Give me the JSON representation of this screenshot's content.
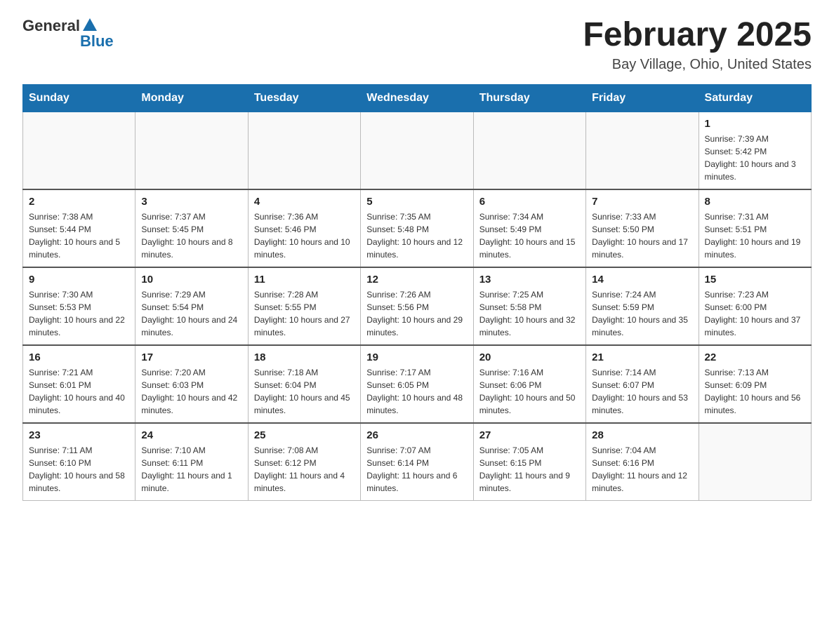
{
  "logo": {
    "general": "General",
    "blue": "Blue"
  },
  "title": "February 2025",
  "location": "Bay Village, Ohio, United States",
  "days_of_week": [
    "Sunday",
    "Monday",
    "Tuesday",
    "Wednesday",
    "Thursday",
    "Friday",
    "Saturday"
  ],
  "weeks": [
    [
      {
        "day": "",
        "info": ""
      },
      {
        "day": "",
        "info": ""
      },
      {
        "day": "",
        "info": ""
      },
      {
        "day": "",
        "info": ""
      },
      {
        "day": "",
        "info": ""
      },
      {
        "day": "",
        "info": ""
      },
      {
        "day": "1",
        "info": "Sunrise: 7:39 AM\nSunset: 5:42 PM\nDaylight: 10 hours and 3 minutes."
      }
    ],
    [
      {
        "day": "2",
        "info": "Sunrise: 7:38 AM\nSunset: 5:44 PM\nDaylight: 10 hours and 5 minutes."
      },
      {
        "day": "3",
        "info": "Sunrise: 7:37 AM\nSunset: 5:45 PM\nDaylight: 10 hours and 8 minutes."
      },
      {
        "day": "4",
        "info": "Sunrise: 7:36 AM\nSunset: 5:46 PM\nDaylight: 10 hours and 10 minutes."
      },
      {
        "day": "5",
        "info": "Sunrise: 7:35 AM\nSunset: 5:48 PM\nDaylight: 10 hours and 12 minutes."
      },
      {
        "day": "6",
        "info": "Sunrise: 7:34 AM\nSunset: 5:49 PM\nDaylight: 10 hours and 15 minutes."
      },
      {
        "day": "7",
        "info": "Sunrise: 7:33 AM\nSunset: 5:50 PM\nDaylight: 10 hours and 17 minutes."
      },
      {
        "day": "8",
        "info": "Sunrise: 7:31 AM\nSunset: 5:51 PM\nDaylight: 10 hours and 19 minutes."
      }
    ],
    [
      {
        "day": "9",
        "info": "Sunrise: 7:30 AM\nSunset: 5:53 PM\nDaylight: 10 hours and 22 minutes."
      },
      {
        "day": "10",
        "info": "Sunrise: 7:29 AM\nSunset: 5:54 PM\nDaylight: 10 hours and 24 minutes."
      },
      {
        "day": "11",
        "info": "Sunrise: 7:28 AM\nSunset: 5:55 PM\nDaylight: 10 hours and 27 minutes."
      },
      {
        "day": "12",
        "info": "Sunrise: 7:26 AM\nSunset: 5:56 PM\nDaylight: 10 hours and 29 minutes."
      },
      {
        "day": "13",
        "info": "Sunrise: 7:25 AM\nSunset: 5:58 PM\nDaylight: 10 hours and 32 minutes."
      },
      {
        "day": "14",
        "info": "Sunrise: 7:24 AM\nSunset: 5:59 PM\nDaylight: 10 hours and 35 minutes."
      },
      {
        "day": "15",
        "info": "Sunrise: 7:23 AM\nSunset: 6:00 PM\nDaylight: 10 hours and 37 minutes."
      }
    ],
    [
      {
        "day": "16",
        "info": "Sunrise: 7:21 AM\nSunset: 6:01 PM\nDaylight: 10 hours and 40 minutes."
      },
      {
        "day": "17",
        "info": "Sunrise: 7:20 AM\nSunset: 6:03 PM\nDaylight: 10 hours and 42 minutes."
      },
      {
        "day": "18",
        "info": "Sunrise: 7:18 AM\nSunset: 6:04 PM\nDaylight: 10 hours and 45 minutes."
      },
      {
        "day": "19",
        "info": "Sunrise: 7:17 AM\nSunset: 6:05 PM\nDaylight: 10 hours and 48 minutes."
      },
      {
        "day": "20",
        "info": "Sunrise: 7:16 AM\nSunset: 6:06 PM\nDaylight: 10 hours and 50 minutes."
      },
      {
        "day": "21",
        "info": "Sunrise: 7:14 AM\nSunset: 6:07 PM\nDaylight: 10 hours and 53 minutes."
      },
      {
        "day": "22",
        "info": "Sunrise: 7:13 AM\nSunset: 6:09 PM\nDaylight: 10 hours and 56 minutes."
      }
    ],
    [
      {
        "day": "23",
        "info": "Sunrise: 7:11 AM\nSunset: 6:10 PM\nDaylight: 10 hours and 58 minutes."
      },
      {
        "day": "24",
        "info": "Sunrise: 7:10 AM\nSunset: 6:11 PM\nDaylight: 11 hours and 1 minute."
      },
      {
        "day": "25",
        "info": "Sunrise: 7:08 AM\nSunset: 6:12 PM\nDaylight: 11 hours and 4 minutes."
      },
      {
        "day": "26",
        "info": "Sunrise: 7:07 AM\nSunset: 6:14 PM\nDaylight: 11 hours and 6 minutes."
      },
      {
        "day": "27",
        "info": "Sunrise: 7:05 AM\nSunset: 6:15 PM\nDaylight: 11 hours and 9 minutes."
      },
      {
        "day": "28",
        "info": "Sunrise: 7:04 AM\nSunset: 6:16 PM\nDaylight: 11 hours and 12 minutes."
      },
      {
        "day": "",
        "info": ""
      }
    ]
  ]
}
